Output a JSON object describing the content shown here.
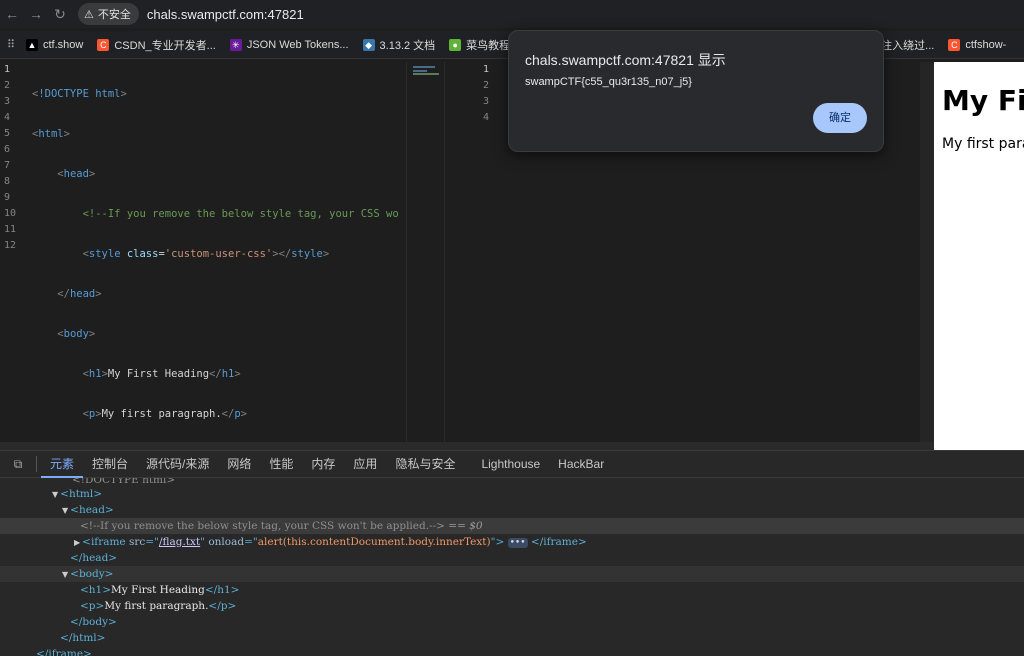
{
  "browser": {
    "security_label": "不安全",
    "url": "chals.swampctf.com:47821"
  },
  "bookmarks": [
    {
      "label": "ctf.show",
      "color": "#000000",
      "glyph": "▲"
    },
    {
      "label": "CSDN_专业开发者...",
      "color": "#fc5531",
      "glyph": "C"
    },
    {
      "label": "JSON Web Tokens...",
      "color": "#6a1b9a",
      "glyph": "✳"
    },
    {
      "label": "3.13.2 文档",
      "color": "#3776ab",
      "glyph": "◆"
    },
    {
      "label": "菜鸟教程",
      "color": "#5fb336",
      "glyph": "●"
    },
    {
      "label": "板注入绕过...",
      "color": "#444444",
      "glyph": ""
    },
    {
      "label": "ctfshow-",
      "color": "#fc5531",
      "glyph": "C"
    }
  ],
  "editor": {
    "line_numbers": [
      "1",
      "2",
      "3",
      "4",
      "5",
      "6",
      "7",
      "8",
      "9",
      "10",
      "11",
      "12"
    ],
    "comment_text": "<!--If you remove the below style tag, your CSS wo",
    "style_class": "'custom-user-css'",
    "h1_text": "My First Heading",
    "p_text": "My first paragraph."
  },
  "editor2": {
    "line_numbers": [
      "1",
      "2",
      "3",
      "4"
    ]
  },
  "preview": {
    "heading": "My Fir",
    "paragraph": "My first parag"
  },
  "dialog": {
    "title": "chals.swampctf.com:47821 显示",
    "message": "swampCTF{c55_qu3r135_n07_j5}",
    "ok_label": "确定"
  },
  "devtools": {
    "tabs": [
      "元素",
      "控制台",
      "源代码/来源",
      "网络",
      "性能",
      "内存",
      "应用",
      "隐私与安全",
      "Lighthouse",
      "HackBar"
    ],
    "active_tab": "元素",
    "dom": {
      "doctype": "<!DOCTYPE html>",
      "comment": "<!--If you remove the below style tag, your CSS won't be applied.-->",
      "selected_marker": "== $0",
      "iframe_src": "/flag.txt",
      "iframe_onload": "alert(this.contentDocument.body.innerText)",
      "h1_text": "My First Heading",
      "p_text": "My first paragraph."
    }
  }
}
